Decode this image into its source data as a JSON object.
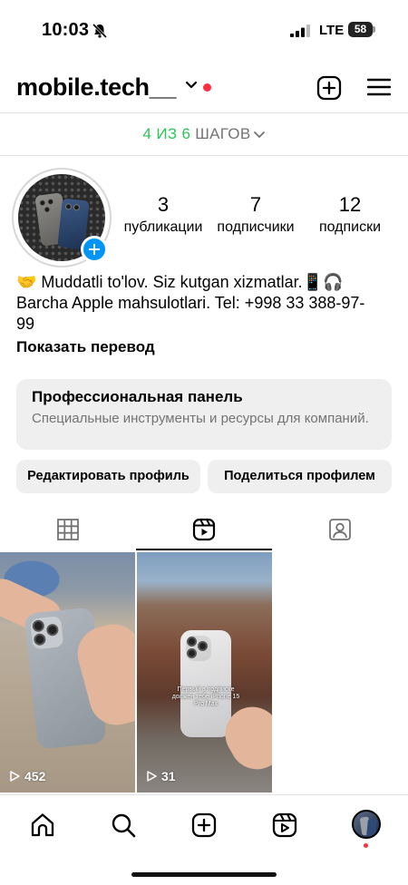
{
  "status_bar": {
    "time": "10:03",
    "network": "LTE",
    "battery": "58",
    "icons": [
      "bell-slash-icon",
      "signal-icon",
      "battery-icon"
    ]
  },
  "header": {
    "username": "mobile.tech__",
    "icons": [
      "chevron-down-icon",
      "add-post-icon",
      "menu-icon"
    ],
    "notification_dot_color": "#ff3040"
  },
  "steps": {
    "done": "4",
    "of": "ИЗ",
    "total": "6",
    "label": "ШАГОВ",
    "accent_color": "#2ec45a"
  },
  "profile": {
    "stats": [
      {
        "value": "3",
        "label": "публикации"
      },
      {
        "value": "7",
        "label": "подписчики"
      },
      {
        "value": "12",
        "label": "подписки"
      }
    ],
    "bio": "🤝 Muddatli to'lov. Siz kutgan xizmatlar.📱🎧 Barcha Apple mahsulotlari. Tel: +998 33 388-97-99",
    "translate_link": "Показать перевод"
  },
  "pro_panel": {
    "title": "Профессиональная панель",
    "subtitle": "Специальные инструменты и ресурсы для компаний."
  },
  "buttons": {
    "edit_profile": "Редактировать профиль",
    "share_profile": "Поделиться профилем"
  },
  "tabs": {
    "items": [
      "grid-icon",
      "reels-icon",
      "tagged-icon"
    ],
    "active": "reels-icon"
  },
  "posts": [
    {
      "views": "452",
      "caption": ""
    },
    {
      "views": "31",
      "caption": "Первый в подписке должен тебе iPhone 15 Pro Max"
    }
  ],
  "bottom_nav": {
    "items": [
      "home-icon",
      "search-icon",
      "create-icon",
      "reels-icon",
      "profile-avatar"
    ]
  },
  "colors": {
    "accent_blue": "#0095f6",
    "button_bg": "#efefef",
    "muted_text": "#737373"
  }
}
